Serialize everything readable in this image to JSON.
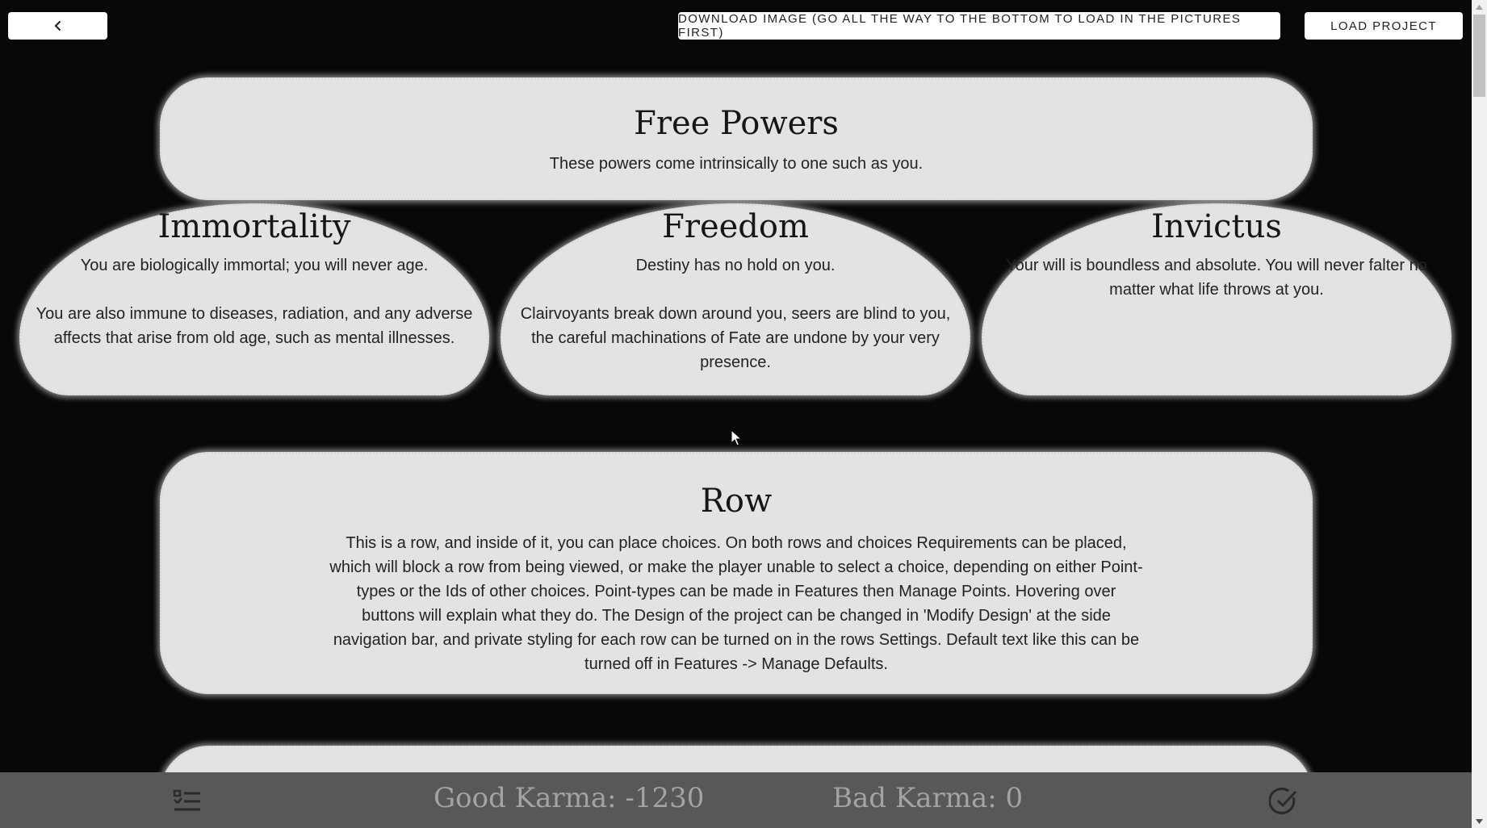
{
  "toolbar": {
    "back_icon": "chevron-left-icon",
    "download_label": "Download Image (Go all the way to the bottom to load in the pictures first)",
    "load_label": "Load Project"
  },
  "free_row": {
    "title": "Free Powers",
    "text": "These powers come intrinsically to one such as you."
  },
  "choices": [
    {
      "title": "Immortality",
      "text": "You are biologically immortal; you will never age.\n\nYou are also immune to diseases, radiation, and any adverse affects that arise from old age, such as mental illnesses."
    },
    {
      "title": "Freedom",
      "text": "Destiny has no hold on you.\n\nClairvoyants break down around you, seers are blind to you, the careful machinations of Fate are undone by your very presence."
    },
    {
      "title": "Invictus",
      "text": "Your will is boundless and absolute. You will never falter no matter what life throws at you."
    }
  ],
  "row": {
    "title": "Row",
    "text": "This is a row, and inside of it, you can place choices. On both rows and choices Requirements can be placed, which will block a row from being viewed, or make the player unable to select a choice, depending on either Point-types or the Ids of other choices. Point-types can be made in Features then Manage Points. Hovering over buttons will explain what they do. The Design of the project can be changed in 'Modify Design' at the side navigation bar, and private styling for each row can be turned on in the rows Settings. Default text like this can be turned off in Features -> Manage Defaults."
  },
  "bottom_bar": {
    "good_karma": "Good Karma: -1230",
    "bad_karma": "Bad Karma: 0",
    "left_icon": "checklist-icon",
    "right_icon": "check-circle-icon"
  },
  "colors": {
    "background": "#080808",
    "card": "#e3e3e3",
    "bottom_bar": "#585858",
    "karma_text": "#a3a3a3"
  }
}
